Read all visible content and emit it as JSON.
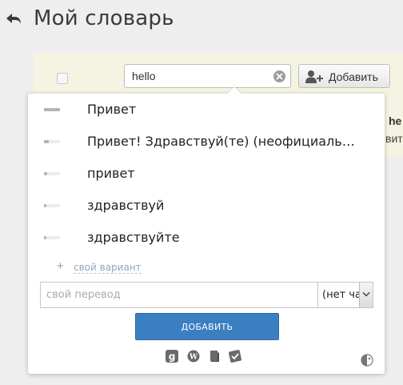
{
  "header": {
    "title": "Мой словарь",
    "back_icon": "back-arrow-icon"
  },
  "search": {
    "value": "hello",
    "clear_icon": "clear-circle-icon"
  },
  "toolbar": {
    "add_label": "Добавить",
    "add_icon": "add-user-icon"
  },
  "background_peek": {
    "word": "he",
    "translation": "вит"
  },
  "suggestions": [
    {
      "label": "Привет",
      "popularity": 1.0
    },
    {
      "label": "Привет! Здравствуй(те) (неофициальное приветствие)",
      "popularity": 0.3
    },
    {
      "label": "привет",
      "popularity": 0.2
    },
    {
      "label": "здравствуй",
      "popularity": 0.15
    },
    {
      "label": "здравствуйте",
      "popularity": 0.15
    }
  ],
  "own_variant": {
    "plus": "+",
    "label": "свой вариант"
  },
  "translation_form": {
    "placeholder": "свой перевод",
    "part_of_speech": "(нет часть речи)",
    "add_button": "ДОБАВИТЬ"
  },
  "dictionary_icons": [
    "google-icon",
    "wikipedia-icon",
    "book-icon",
    "dictionary-icon"
  ],
  "colors": {
    "accent": "#3a7fc1",
    "panel_bg": "#f5f4e3",
    "link": "#8ea7c4"
  }
}
